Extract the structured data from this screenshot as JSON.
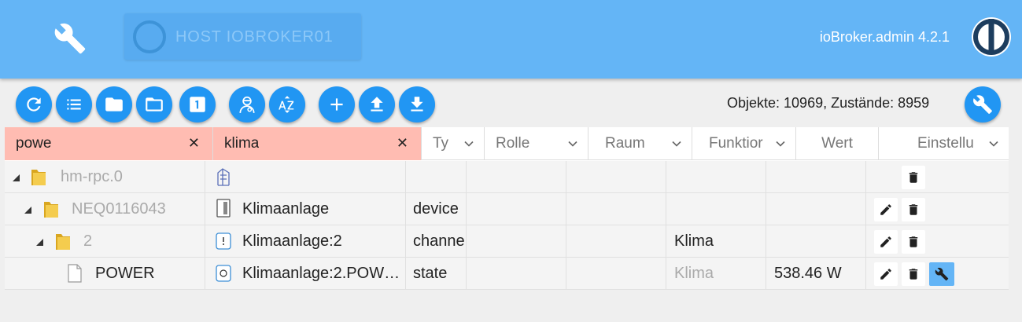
{
  "topbar": {
    "host_label": "HOST IOBROKER01",
    "version": "ioBroker.admin 4.2.1"
  },
  "toolbar": {
    "buttons": [
      "refresh-icon",
      "list-icon",
      "folder-filled-icon",
      "folder-outline-icon",
      "one-icon",
      "expert-icon",
      "sort-az-icon",
      "add-icon",
      "upload-icon",
      "download-icon"
    ],
    "count": "Objekte: 10969, Zustände: 8959"
  },
  "columns": {
    "id_filter": "powe",
    "name_filter": "klima",
    "type": "Ty",
    "role": "Rolle",
    "room": "Raum",
    "function": "Funktior",
    "value": "Wert",
    "settings": "Einstellu"
  },
  "rows": [
    {
      "id": "hm-rpc.0",
      "name": "",
      "type": "",
      "role": "",
      "room": "",
      "function": "",
      "value": ""
    },
    {
      "id": "NEQ0116043",
      "name": "Klimaanlage",
      "type": "device",
      "role": "",
      "room": "",
      "function": "",
      "value": ""
    },
    {
      "id": "2",
      "name": "Klimaanlage:2",
      "type": "channe",
      "role": "",
      "room": "",
      "function": "Klima",
      "value": ""
    },
    {
      "id": "POWER",
      "name": "Klimaanlage:2.POW…",
      "type": "state",
      "role": "",
      "room": "",
      "function": "Klima",
      "value": "538.46 W"
    }
  ],
  "colors": {
    "topbar": "#64b5f6",
    "button": "#2196f3",
    "filter_bg": "#ffbcb2"
  }
}
